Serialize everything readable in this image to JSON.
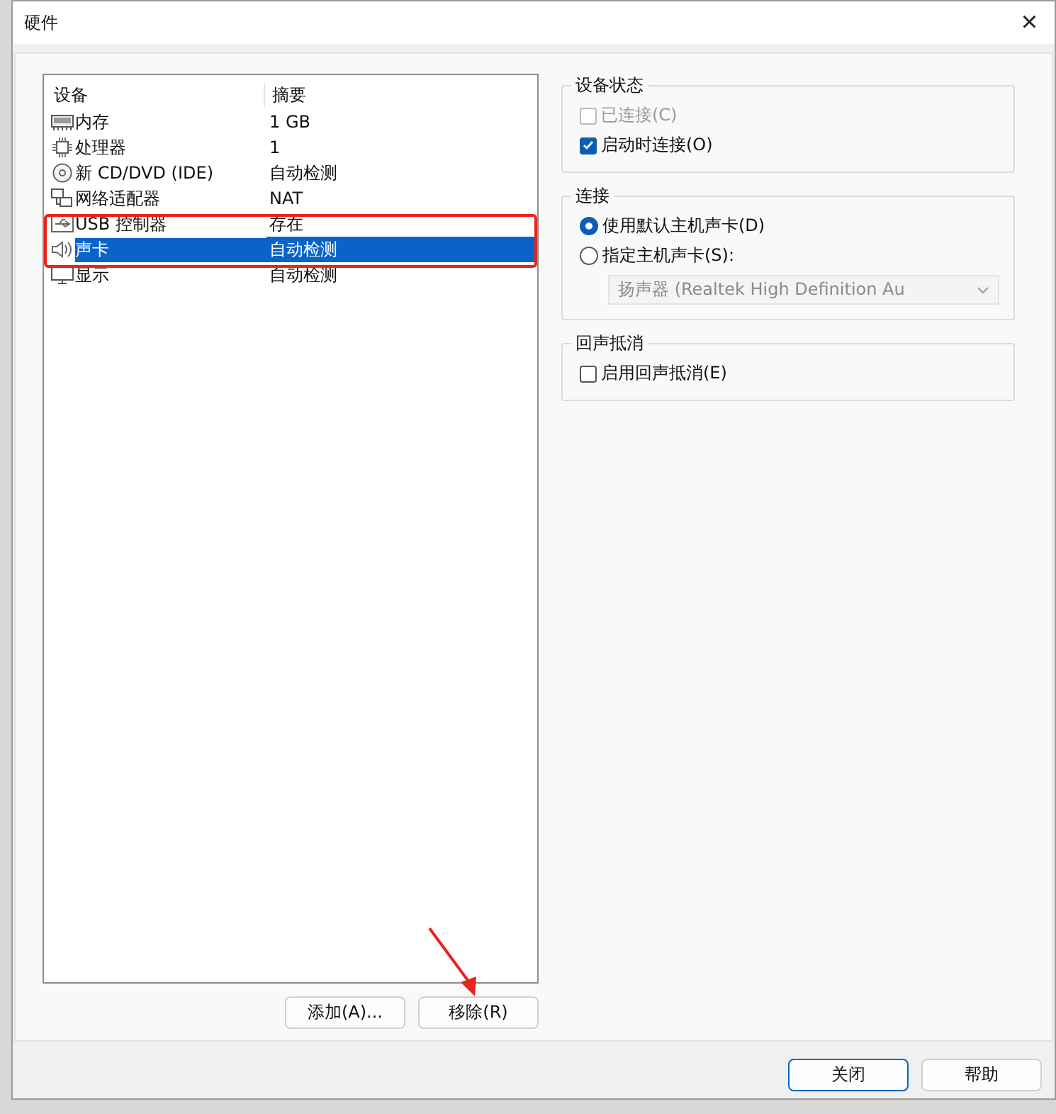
{
  "window": {
    "title": "硬件",
    "close": "×"
  },
  "device_list": {
    "columns": [
      "设备",
      "摘要"
    ],
    "rows": [
      {
        "kind": "memory",
        "device": "内存",
        "summary": "1 GB",
        "selected": false
      },
      {
        "kind": "cpu",
        "device": "处理器",
        "summary": "1",
        "selected": false
      },
      {
        "kind": "cd",
        "device": "新 CD/DVD (IDE)",
        "summary": "自动检测",
        "selected": false
      },
      {
        "kind": "network",
        "device": "网络适配器",
        "summary": "NAT",
        "selected": false
      },
      {
        "kind": "usb",
        "device": "USB 控制器",
        "summary": "存在",
        "selected": false
      },
      {
        "kind": "sound",
        "device": "声卡",
        "summary": "自动检测",
        "selected": true
      },
      {
        "kind": "display",
        "device": "显示",
        "summary": "自动检测",
        "selected": false
      }
    ]
  },
  "list_buttons": [
    "添加(A)...",
    "移除(R)"
  ],
  "groups": [
    {
      "title": "设备状态",
      "items": [
        {
          "kind": "checkbox",
          "label": "已连接(C)",
          "checked": false,
          "disabled": true
        },
        {
          "kind": "checkbox",
          "label": "启动时连接(O)",
          "checked": true,
          "disabled": false
        }
      ]
    },
    {
      "title": "连接",
      "items": [
        {
          "kind": "radio",
          "label": "使用默认主机声卡(D)",
          "selected": true,
          "disabled": false
        },
        {
          "kind": "radio",
          "label": "指定主机声卡(S):",
          "selected": false,
          "disabled": false
        },
        {
          "kind": "dropdown",
          "value": "扬声器 (Realtek High Definition Au",
          "disabled": true
        }
      ]
    },
    {
      "title": "回声抵消",
      "items": [
        {
          "kind": "checkbox",
          "label": "启用回声抵消(E)",
          "checked": false,
          "disabled": false
        }
      ]
    }
  ],
  "dialog_buttons": [
    "关闭",
    "帮助"
  ],
  "annotations": {
    "highlight_box": true,
    "arrow": true
  }
}
